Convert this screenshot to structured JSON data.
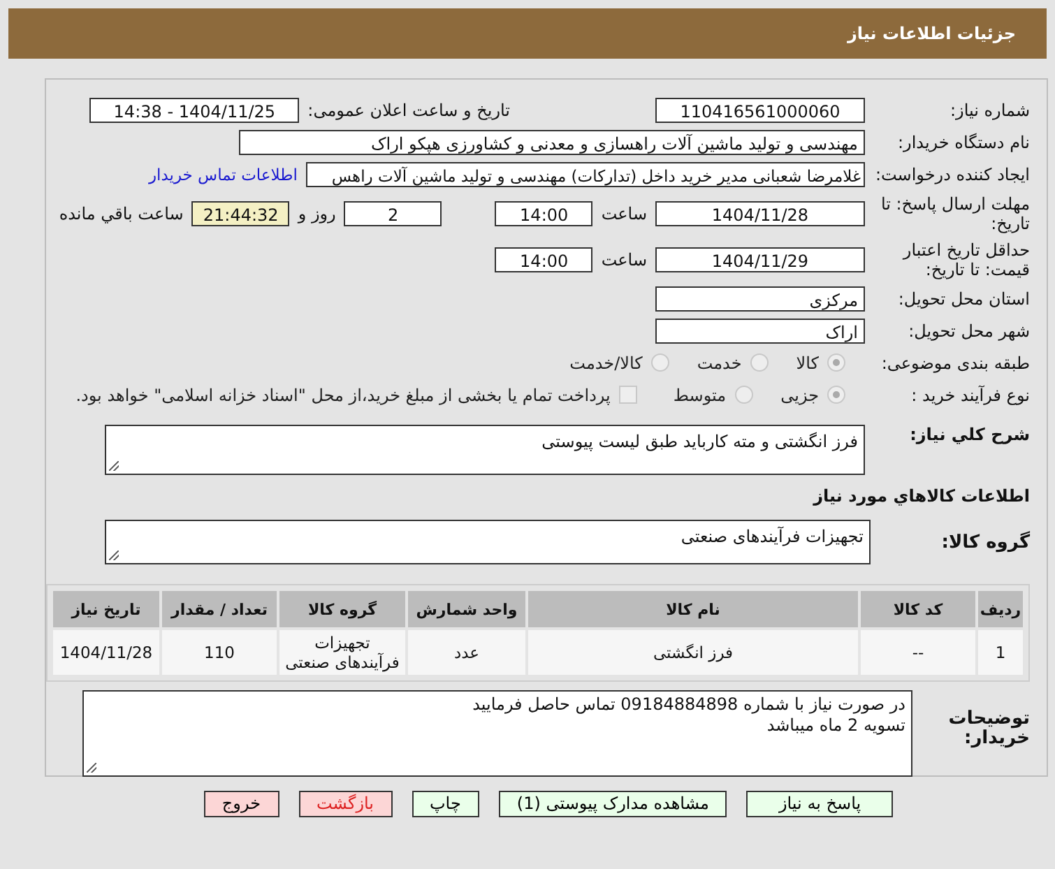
{
  "page_title": "جزئیات اطلاعات نیاز",
  "need_number": {
    "label": "شماره نیاز:",
    "value": "110416561000060"
  },
  "announce": {
    "label": "تاریخ و ساعت اعلان عمومی:",
    "value": "1404/11/25 - 14:38"
  },
  "buyer_org": {
    "label": "نام دستگاه خریدار:",
    "value": "مهندسی و تولید ماشین آلات راهسازی و معدنی و کشاورزی هپکو اراک"
  },
  "requester": {
    "label": "ایجاد کننده درخواست:",
    "value": "غلامرضا شعبانی مدیر خرید داخل (تدارکات) مهندسی و تولید ماشین آلات راهس",
    "link": "اطلاعات تماس خریدار"
  },
  "reply_deadline": {
    "label": "مهلت ارسال پاسخ: تا تاریخ:",
    "date": "1404/11/28",
    "time_label": "ساعت",
    "time": "14:00",
    "days": "2",
    "days_label": "روز و",
    "remaining": "21:44:32",
    "remaining_label": "ساعت باقي مانده"
  },
  "price_validity": {
    "label": "حداقل تاریخ اعتبار قیمت: تا تاریخ:",
    "date": "1404/11/29",
    "time_label": "ساعت",
    "time": "14:00"
  },
  "province": {
    "label": "استان محل تحویل:",
    "value": "مرکزی"
  },
  "city": {
    "label": "شهر محل تحویل:",
    "value": "اراک"
  },
  "category": {
    "label": "طبقه بندی موضوعی:",
    "options": [
      {
        "label": "کالا",
        "selected": true
      },
      {
        "label": "خدمت",
        "selected": false
      },
      {
        "label": "کالا/خدمت",
        "selected": false
      }
    ]
  },
  "process": {
    "label": "نوع فرآیند خرید :",
    "options": [
      {
        "label": "جزیی",
        "selected": true
      },
      {
        "label": "متوسط",
        "selected": false
      }
    ],
    "treasury": {
      "label": "پرداخت تمام یا بخشی از مبلغ خرید،از محل \"اسناد خزانه اسلامی\" خواهد بود.",
      "checked": false
    }
  },
  "description": {
    "label": "شرح کلي نیاز:",
    "value": "فرز انگشتی و مته کارباید طبق لیست پیوستی"
  },
  "goods_heading": "اطلاعات کالاهاي مورد نیاز",
  "goods_group": {
    "label": "گروه کالا:",
    "value": "تجهیزات فرآیندهای صنعتی"
  },
  "table": {
    "columns": [
      "ردیف",
      "کد کالا",
      "نام کالا",
      "واحد شمارش",
      "گروه کالا",
      "تعداد / مقدار",
      "تاریخ نیاز"
    ],
    "rows": [
      [
        "1",
        "--",
        "فرز انگشتی",
        "عدد",
        "تجهیزات فرآیندهای صنعتی",
        "110",
        "1404/11/28"
      ]
    ]
  },
  "buyer_notes": {
    "label": "توضیحات خریدار:",
    "lines": [
      "در صورت نیاز با شماره 09184884898 تماس حاصل فرمایید",
      "تسویه 2 ماه میباشد"
    ]
  },
  "buttons": [
    {
      "label": "پاسخ به نیاز",
      "kind": "action"
    },
    {
      "label": "مشاهده مدارک پیوستی (1)",
      "kind": "action"
    },
    {
      "label": "چاپ",
      "kind": "action"
    },
    {
      "label": "بازگشت",
      "kind": "back"
    },
    {
      "label": "خروج",
      "kind": "exit"
    }
  ]
}
